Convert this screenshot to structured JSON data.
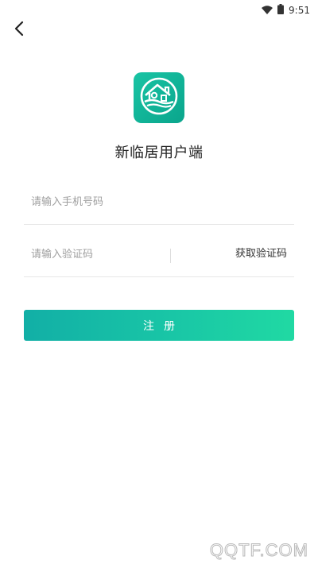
{
  "status_bar": {
    "time": "9:51",
    "wifi_icon": "wifi-icon",
    "battery_icon": "battery-icon"
  },
  "nav": {
    "back_icon": "chevron-left-icon"
  },
  "app": {
    "logo_icon": "house-logo-icon",
    "name": "新临居用户端",
    "brand_color": "#12b59a"
  },
  "form": {
    "phone": {
      "placeholder": "请输入手机号码",
      "value": ""
    },
    "code": {
      "placeholder": "请输入验证码",
      "value": "",
      "get_code_label": "获取验证码"
    },
    "register_label": "注册"
  },
  "watermark": "QQTF.COM"
}
